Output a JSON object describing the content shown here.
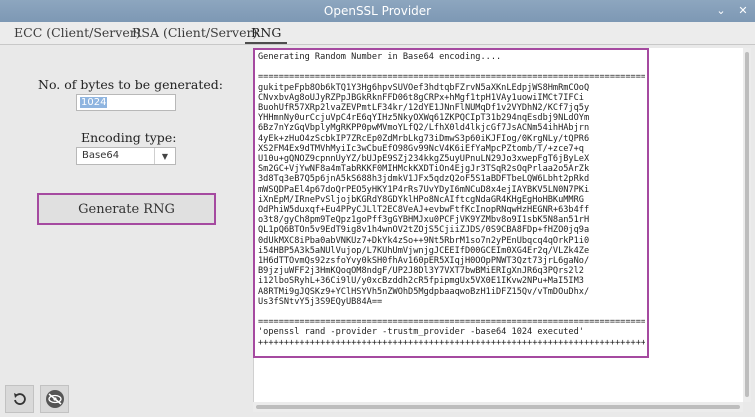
{
  "window": {
    "title": "OpenSSL Provider"
  },
  "tabs": [
    {
      "label": "ECC (Client/Server)"
    },
    {
      "label": "RSA (Client/Server)"
    },
    {
      "label": "RNG"
    }
  ],
  "active_tab": "RNG",
  "form": {
    "bytes_label": "No. of bytes to be generated:",
    "bytes_value": "1024",
    "encoding_label": "Encoding type:",
    "encoding_value": "Base64",
    "generate_label": "Generate RNG"
  },
  "output": {
    "text": "Generating Random Number in Base64 encoding....\n\n================================================================================\ngukitpeFpb8Ob6kTQ1Y3Hg6hpvSUVOef3hdtqbFZrvN5aXKnLEdpjWS8HmRmCOoQ\nCNvxbvAg8oUJyRZPpJBGkRknFFD06t8gCRPx+hMgf1tpH1VAy1uowiIMCt7IFCi\nBuohUfR57XRp2lvaZEVPmtLF34kr/12dYE1JNnFlNUMqDf1v2VYDhN2/KCf7jq5y\nYHHmnNy0urCcjuVpC4rE6qYIHz5NkyOXWq61ZKPQCIpT31b294nqEsdbj9NLdOYm\n6Bz7nYzGqVbplyMgRKPP0pwMVmoYLfQ2/LfhX0ld4lkjcGf7JsACNm54ihHAbjrn\n4yEk+zHuO4zScbkIP7ZRcEp0ZdMrbLkg73iDmwS3p60iKJFIog/0KrgNLy/tQPR6\nXS2FM4Ex9dTMVhMyiIc3wCbuEfO98Gv99NcV4K6iEfYaMpcPZtomb/T/+zce7+q\nU10u+gQNOZ9cpnnUyYZ/bUJpE9SZj234kkgZ5uyUPnuLN29Jo3xwepFgT6jByLeX\nSm2GC+VjYwNF8a4mTabRKKF0MIHMckKXDTiOn4EjgJr3TSqR2sOqPrlaa2o5ArZk\n3d8Tq3eB7Q5p6jnA5kS688h3jdmkV1JFx5qdzQ2oF5S1aBDFTbeLQW6Lbht2pRkd\nmWSQDPaEl4p67doQrPEO5yHKY1P4rRs7UvYDyI6mNCuD8x4ejIAYBKV5LN0N7PKi\niXnEpM/IRnePvSljojbKGRdY8GDYklHPo8NcAIftcgNdaGR4KHgEgHoHBKuMMRG\nOdPhiW5duxqf+Eu4PPyCJLlT2EC8VeAJ+evbwFtfKcInopRNqwHzHEGNR+63b4ff\no3t8/gyCh8pm9TeQpz1goPff3gGYBHMJxu0PCFjVK9YZMbv8o9I1sbK5N8an51rH\nQL1pQ6BTOn5v9EdT9ig8v1h4wnOV2tZOjS5CjiiZJDS/0S9CBA8FDp+fHZO0jq9a\n0dUkMXC8iPba0abVNKUz7+DkYk4zSo++9Nt5RbrM1so7n2yPEnUbqcq4qOrkP1i0\ni54HBP5A3k5aNUlVujop/L7KUhUmVjwnjgJCEEIfD00GCEIm0XG4Er2q/VLZk4Ze\n1H6dTTOvmQs92zsfoYvy0kSH0fhAv160pER5XIqjH0OOpPNWT3Qzt73jrL6gaNo/\nB9jzjuWFF2j3HmKQoqOM8ndgF/UP2J8Dl3Y7VXT7bwBMiERIgXnJR6q3PQrs2l2\ni12lboSRyhL+36Ci9lU/y0xcBzddh2cR5fpipmgUx5VX0E1IKvw2NPu+MaI5IM3\nA8RTMi9gJQSKz9+YClHSYVh5nZWOhD5MgdpbaaqwoBzH1iDFZ15Qv/vTmDOuDhx/\nUs3fSNtvY5j3S9EQyUB84A==\n\n================================================================================\n'openssl rand -provider -trustm_provider -base64 1024 executed'\n++++++++++++++++++++++++++++++++++++++++++++++++++++++++++++++++++++++++++++++++++++++"
  },
  "icons": {
    "back": "undo-arrow-icon",
    "eye": "eye-slash-icon"
  },
  "colors": {
    "highlight": "#a54aa0",
    "titlebar": "#8da6bf"
  }
}
